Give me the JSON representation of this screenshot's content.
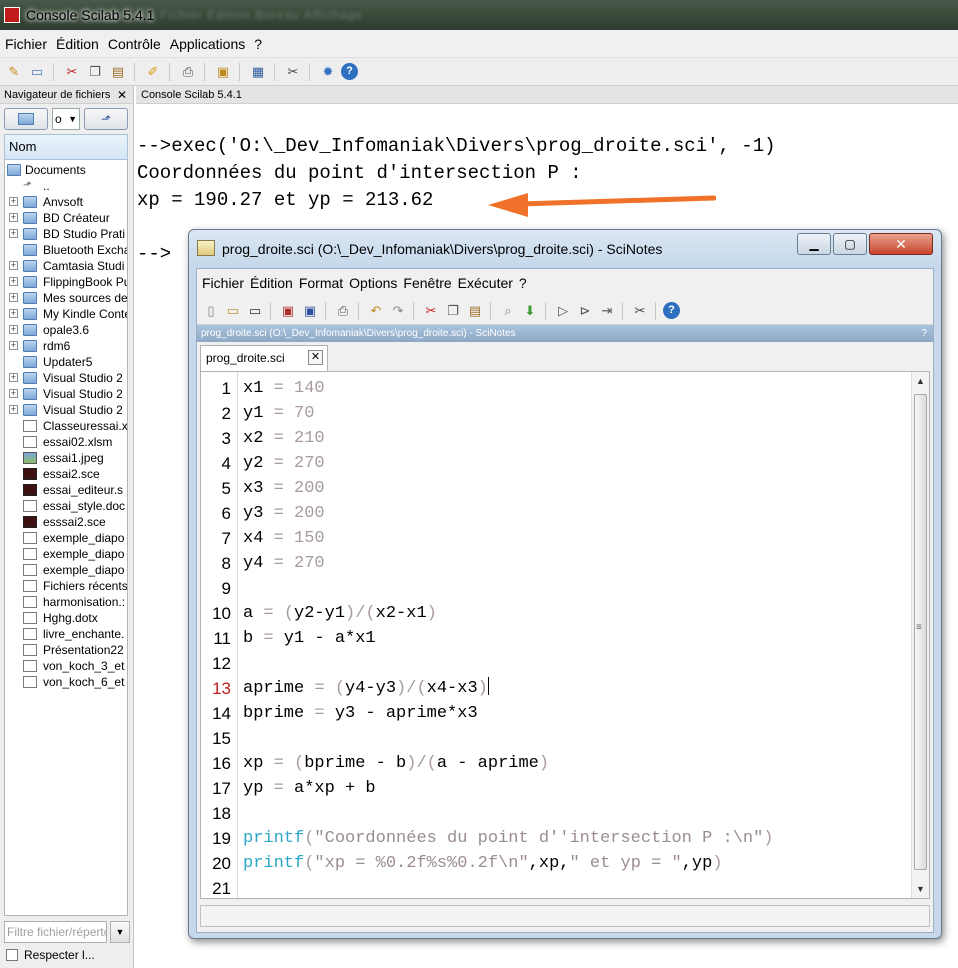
{
  "main_window": {
    "title": "Console Scilab 5.4.1",
    "background_text": "Fichier   Édition   Bureau   Affichage"
  },
  "menubar": [
    "Fichier",
    "Édition",
    "Contrôle",
    "Applications",
    "?"
  ],
  "toolbar_icons": [
    "new-script-icon",
    "open-icon",
    "cut-icon",
    "copy-icon",
    "paste-icon",
    "change-dir-icon",
    "print-icon",
    "clear-console-icon",
    "variable-browser-icon",
    "demos-icon",
    "atoms-icon",
    "help-icon"
  ],
  "file_browser": {
    "header": "Navigateur de fichiers",
    "combo_value": "o",
    "column_header": "Nom",
    "filter_placeholder": "Filtre fichier/répertoire",
    "checkbox_label": "Respecter l...",
    "tree": [
      {
        "label": "Documents",
        "icon": "folder",
        "expand": ""
      },
      {
        "label": "..",
        "icon": "up",
        "expand": ""
      },
      {
        "label": "Anvsoft",
        "icon": "folder",
        "expand": "+"
      },
      {
        "label": "BD Créateur",
        "icon": "folder",
        "expand": "+"
      },
      {
        "label": "BD Studio Prati",
        "icon": "folder",
        "expand": "+"
      },
      {
        "label": "Bluetooth Excha",
        "icon": "folder",
        "expand": ""
      },
      {
        "label": "Camtasia Studi",
        "icon": "folder",
        "expand": "+"
      },
      {
        "label": "FlippingBook Pu",
        "icon": "folder",
        "expand": "+"
      },
      {
        "label": "Mes sources de",
        "icon": "folder",
        "expand": "+"
      },
      {
        "label": "My Kindle Conte",
        "icon": "folder",
        "expand": "+"
      },
      {
        "label": "opale3.6",
        "icon": "folder",
        "expand": "+"
      },
      {
        "label": "rdm6",
        "icon": "folder",
        "expand": "+"
      },
      {
        "label": "Updater5",
        "icon": "folder",
        "expand": ""
      },
      {
        "label": "Visual Studio 2",
        "icon": "folder",
        "expand": "+"
      },
      {
        "label": "Visual Studio 2",
        "icon": "folder",
        "expand": "+"
      },
      {
        "label": "Visual Studio 2",
        "icon": "folder",
        "expand": "+"
      },
      {
        "label": "Classeuressai.x",
        "icon": "doc",
        "expand": ""
      },
      {
        "label": "essai02.xlsm",
        "icon": "doc",
        "expand": ""
      },
      {
        "label": "essai1.jpeg",
        "icon": "img",
        "expand": ""
      },
      {
        "label": "essai2.sce",
        "icon": "sce",
        "expand": ""
      },
      {
        "label": "essai_editeur.s",
        "icon": "sce",
        "expand": ""
      },
      {
        "label": "essai_style.doc",
        "icon": "doc",
        "expand": ""
      },
      {
        "label": "esssai2.sce",
        "icon": "sce",
        "expand": ""
      },
      {
        "label": "exemple_diapo",
        "icon": "doc",
        "expand": ""
      },
      {
        "label": "exemple_diapo",
        "icon": "doc",
        "expand": ""
      },
      {
        "label": "exemple_diapo",
        "icon": "doc",
        "expand": ""
      },
      {
        "label": "Fichiers récents",
        "icon": "doc",
        "expand": ""
      },
      {
        "label": "harmonisation.:",
        "icon": "doc",
        "expand": ""
      },
      {
        "label": "Hghg.dotx",
        "icon": "doc",
        "expand": ""
      },
      {
        "label": "livre_enchante.",
        "icon": "doc",
        "expand": ""
      },
      {
        "label": "Présentation22",
        "icon": "doc",
        "expand": ""
      },
      {
        "label": "von_koch_3_et",
        "icon": "doc",
        "expand": ""
      },
      {
        "label": "von_koch_6_et",
        "icon": "doc",
        "expand": ""
      }
    ]
  },
  "console": {
    "tab_label": "Console Scilab 5.4.1",
    "lines": [
      "-->exec('O:\\_Dev_Infomaniak\\Divers\\prog_droite.sci', -1)",
      "Coordonnées du point d'intersection P :",
      "xp = 190.27 et yp = 213.62",
      "",
      "-->"
    ],
    "annotation_color": "#f0722a"
  },
  "scinotes": {
    "title": "prog_droite.sci (O:\\_Dev_Infomaniak\\Divers\\prog_droite.sci) - SciNotes",
    "menubar": [
      "Fichier",
      "Édition",
      "Format",
      "Options",
      "Fenêtre",
      "Exécuter",
      "?"
    ],
    "pathbar": "prog_droite.sci (O:\\_Dev_Infomaniak\\Divers\\prog_droite.sci) - SciNotes",
    "pathbar_help": "?",
    "tab_label": "prog_droite.sci",
    "current_line": 13,
    "lines": [
      "x1 = 140",
      "y1 = 70",
      "x2 = 210",
      "y2 = 270",
      "x3 = 200",
      "y3 = 200",
      "x4 = 150",
      "y4 = 270",
      "",
      "a = (y2-y1)/(x2-x1)",
      "b = y1 - a*x1",
      "",
      "aprime = (y4-y3)/(x4-x3)",
      "bprime = y3 - aprime*x3",
      "",
      "xp = (bprime - b)/(a - aprime)",
      "yp = a*xp + b",
      "",
      "printf(\"Coordonnées du point d''intersection P :\\n\")",
      "printf(\"xp = %0.2f%s%0.2f\\n\",xp,\" et yp = \",yp)",
      ""
    ]
  }
}
